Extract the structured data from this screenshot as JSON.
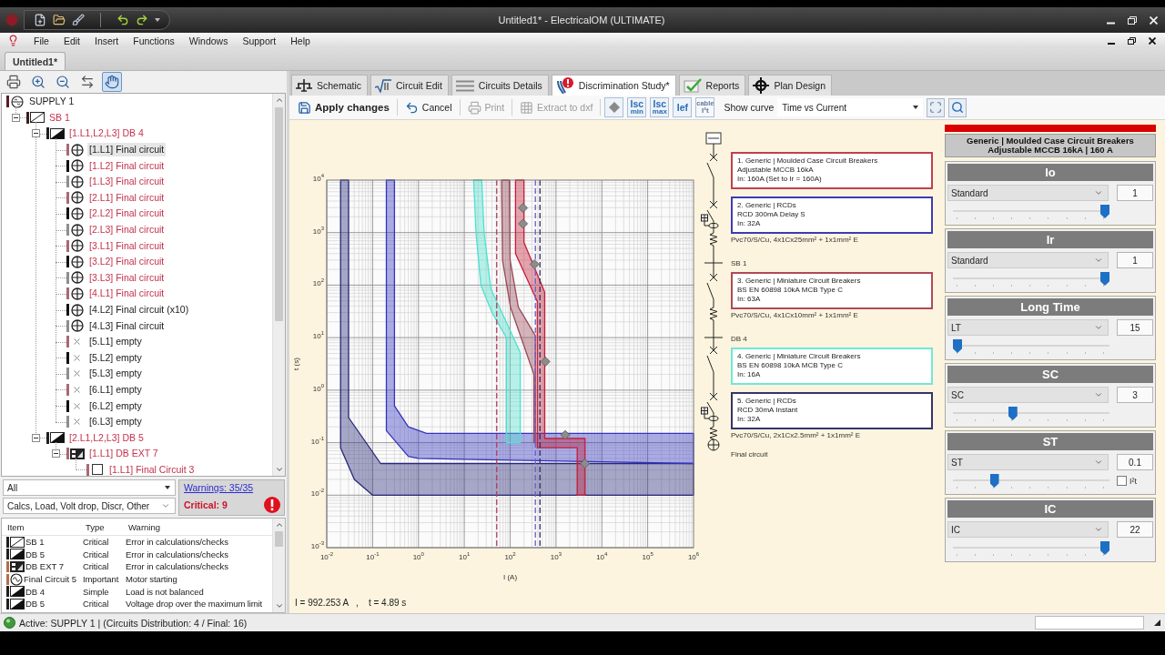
{
  "window": {
    "title": "Untitled1* - ElectricalOM (ULTIMATE)"
  },
  "menu": [
    "File",
    "Edit",
    "Insert",
    "Functions",
    "Windows",
    "Support",
    "Help"
  ],
  "document_tabs": [
    {
      "label": "Untitled1*",
      "selected": true
    }
  ],
  "tree_toolbar": [
    {
      "kind": "print",
      "pressed": false
    },
    {
      "kind": "zoom_in",
      "pressed": false
    },
    {
      "kind": "zoom_out",
      "pressed": false
    },
    {
      "kind": "swap",
      "pressed": false
    },
    {
      "kind": "hand",
      "pressed": true
    }
  ],
  "tree": [
    {
      "label": "SUPPLY 1",
      "kind": "supply",
      "color": "#5a1c24",
      "error": false,
      "selected": false,
      "children": [
        {
          "label": "SB 1",
          "kind": "switchboard",
          "color": "#3a2020",
          "error": true,
          "selected": false,
          "expanded": true,
          "children": [
            {
              "label": "[1.L1,L2,L3] DB 4",
              "kind": "board",
              "color": "#202020",
              "error": true,
              "selected": false,
              "expanded": true,
              "children": [
                {
                  "label": "[1.L1] Final circuit",
                  "kind": "final_circuit",
                  "color": "#a86a72",
                  "error": false,
                  "selected": true
                },
                {
                  "label": "[1.L2] Final circuit",
                  "kind": "final_circuit",
                  "color": "#111111",
                  "error": true,
                  "selected": false
                },
                {
                  "label": "[1.L3] Final circuit",
                  "kind": "final_circuit",
                  "color": "#8e8e8e",
                  "error": true,
                  "selected": false
                },
                {
                  "label": "[2.L1] Final circuit",
                  "kind": "final_circuit",
                  "color": "#a86a72",
                  "error": true,
                  "selected": false
                },
                {
                  "label": "[2.L2] Final circuit",
                  "kind": "final_circuit",
                  "color": "#111111",
                  "error": true,
                  "selected": false
                },
                {
                  "label": "[2.L3] Final circuit",
                  "kind": "final_circuit",
                  "color": "#8e8e8e",
                  "error": true,
                  "selected": false
                },
                {
                  "label": "[3.L1] Final circuit",
                  "kind": "final_circuit",
                  "color": "#a86a72",
                  "error": true,
                  "selected": false
                },
                {
                  "label": "[3.L2] Final circuit",
                  "kind": "final_circuit",
                  "color": "#111111",
                  "error": true,
                  "selected": false
                },
                {
                  "label": "[3.L3] Final circuit",
                  "kind": "final_circuit",
                  "color": "#8e8e8e",
                  "error": true,
                  "selected": false
                },
                {
                  "label": "[4.L1] Final circuit",
                  "kind": "final_circuit",
                  "color": "#a86a72",
                  "error": true,
                  "selected": false
                },
                {
                  "label": "[4.L2] Final circuit (x10)",
                  "kind": "final_circuit",
                  "color": "#111111",
                  "error": false,
                  "selected": false
                },
                {
                  "label": "[4.L3] Final circuit",
                  "kind": "final_circuit",
                  "color": "#8e8e8e",
                  "error": false,
                  "selected": false
                },
                {
                  "label": "[5.L1] empty",
                  "kind": "empty",
                  "color": "#a86a72",
                  "error": false,
                  "selected": false
                },
                {
                  "label": "[5.L2] empty",
                  "kind": "empty",
                  "color": "#111111",
                  "error": false,
                  "selected": false
                },
                {
                  "label": "[5.L3] empty",
                  "kind": "empty",
                  "color": "#8e8e8e",
                  "error": false,
                  "selected": false
                },
                {
                  "label": "[6.L1] empty",
                  "kind": "empty",
                  "color": "#a86a72",
                  "error": false,
                  "selected": false
                },
                {
                  "label": "[6.L2] empty",
                  "kind": "empty",
                  "color": "#111111",
                  "error": false,
                  "selected": false
                },
                {
                  "label": "[6.L3] empty",
                  "kind": "empty",
                  "color": "#8e8e8e",
                  "error": false,
                  "selected": false
                }
              ]
            },
            {
              "label": "[2.L1,L2,L3] DB 5",
              "kind": "board",
              "color": "#202020",
              "error": true,
              "selected": false,
              "expanded": true,
              "children": [
                {
                  "label": "[1.L1] DB EXT 7",
                  "kind": "ext_board",
                  "color": "#a86a72",
                  "error": true,
                  "selected": false,
                  "expanded": true,
                  "children": [
                    {
                      "label": "[1.L1] Final Circuit 3",
                      "kind": "circuit",
                      "color": "#a86a72",
                      "error": true,
                      "selected": false
                    }
                  ]
                }
              ]
            }
          ]
        }
      ]
    }
  ],
  "warnings": {
    "filter": "All",
    "categories": "Calcs, Load, Volt drop, Discr, Other",
    "summary_link": "Warnings: 35/35",
    "critical": "Critical: 9",
    "columns": [
      "Item",
      "Type",
      "Warning"
    ],
    "rows": [
      {
        "kind": "switchboard",
        "color": "#202020",
        "item": "SB 1",
        "type": "Critical",
        "warning": "Error in calculations/checks"
      },
      {
        "kind": "board",
        "color": "#202020",
        "item": "DB 5",
        "type": "Critical",
        "warning": "Error in calculations/checks"
      },
      {
        "kind": "ext_board",
        "color": "#b0704a",
        "item": "DB EXT 7",
        "type": "Critical",
        "warning": "Error in calculations/checks"
      },
      {
        "kind": "motor",
        "color": "#b0704a",
        "item": "Final Circuit 5",
        "type": "Important",
        "warning": "Motor starting"
      },
      {
        "kind": "board",
        "color": "#202020",
        "item": "DB 4",
        "type": "Simple",
        "warning": "Load is not balanced"
      },
      {
        "kind": "board",
        "color": "#202020",
        "item": "DB 5",
        "type": "Critical",
        "warning": "Voltage drop over the maximum limit"
      }
    ]
  },
  "tabs": [
    {
      "kind": "schematic",
      "label": "Schematic",
      "selected": false
    },
    {
      "kind": "circuit_edit",
      "label": "Circuit Edit",
      "selected": false
    },
    {
      "kind": "details",
      "label": "Circuits Details",
      "selected": false
    },
    {
      "kind": "discrimination",
      "label": "Discrimination Study*",
      "selected": true
    },
    {
      "kind": "reports",
      "label": "Reports",
      "selected": false
    },
    {
      "kind": "plan",
      "label": "Plan Design",
      "selected": false
    }
  ],
  "toolbar": {
    "buttons": [
      {
        "kind": "save",
        "label": "Apply changes",
        "disabled": false
      },
      {
        "kind": "undo",
        "label": "Cancel",
        "disabled": false
      },
      {
        "kind": "print",
        "label": "Print",
        "disabled": true
      },
      {
        "kind": "dxf",
        "label": "Extract to dxf",
        "disabled": true
      }
    ],
    "toggles": [
      {
        "kind": "diamond",
        "disabled": false
      },
      {
        "kind": "text",
        "top": "Isc",
        "bottom": "min",
        "disabled": false
      },
      {
        "kind": "text",
        "top": "Isc",
        "bottom": "max",
        "disabled": false
      },
      {
        "kind": "text",
        "top": "Ief",
        "disabled": false
      },
      {
        "kind": "text",
        "top": "cable",
        "bottom": "I²t",
        "disabled": true
      }
    ],
    "curve_label": "Show curve",
    "curve_select": "Time vs Current"
  },
  "study": {
    "chart_data": [
      {
        "type": "area",
        "xlabel": "I (A)",
        "ylabel": "t (s)",
        "log": "both",
        "grid": true,
        "xlim": [
          0.01,
          1000000
        ],
        "ylim": [
          0.001,
          10000
        ],
        "xticks": [
          {
            "value": 0.01,
            "label": "10$^{-2}$"
          },
          {
            "value": 0.1,
            "label": "10$^{-1}$"
          },
          {
            "value": 1,
            "label": "10$^{0}$"
          },
          {
            "value": 10,
            "label": "10$^{1}$"
          },
          {
            "value": 100,
            "label": "10$^{2}$"
          },
          {
            "value": 1000,
            "label": "10$^{3}$"
          },
          {
            "value": 10000,
            "label": "10$^{4}$"
          },
          {
            "value": 100000,
            "label": "10$^{5}$"
          },
          {
            "value": 1000000,
            "label": "10$^{6}$"
          }
        ],
        "yticks": [
          {
            "value": 0.001,
            "label": "10$^{-3}$"
          },
          {
            "value": 0.01,
            "label": "10$^{-2}$"
          },
          {
            "value": 0.1,
            "label": "10$^{-1}$"
          },
          {
            "value": 1,
            "label": "10$^{0}$"
          },
          {
            "value": 10,
            "label": "10$^{1}$"
          },
          {
            "value": 100,
            "label": "10$^{2}$"
          },
          {
            "value": 1000,
            "label": "10$^{3}$"
          },
          {
            "value": 10000,
            "label": "10$^{4}$"
          }
        ],
        "series": [
          {
            "color": "#28287a",
            "x": [
              0.02,
              0.02,
              0.04,
              0.1,
              1000000,
              1000000,
              0.15,
              0.03,
              0.03
            ],
            "values": [
              10000,
              0.08,
              0.02,
              0.01,
              0.01,
              0.04,
              0.04,
              0.3,
              10000
            ]
          },
          {
            "color": "#3434c0",
            "x": [
              0.2,
              0.2,
              0.6,
              1,
              1000000,
              1000000,
              1.5,
              0.6,
              0.3,
              0.3
            ],
            "values": [
              10000,
              0.17,
              0.055,
              0.05,
              0.04,
              0.15,
              0.15,
              0.2,
              0.5,
              10000
            ]
          },
          {
            "color": "#4fe0d0",
            "x": [
              16,
              18,
              23,
              41,
              83,
              83,
              166,
              166,
              89,
              38,
              27,
              24
            ],
            "values": [
              10000,
              1000,
              100,
              29,
              10,
              0.1,
              0.1,
              5.2,
              17,
              85,
              1000,
              10000
            ]
          },
          {
            "color": "#9a4a5a",
            "x": [
              65,
              68,
              102,
              330,
              330,
              355,
              355,
              151,
              100,
              96
            ],
            "values": [
              10000,
              300,
              38,
              2,
              0.1,
              0.1,
              11,
              38,
              300,
              10000
            ]
          },
          {
            "color": "#c41e3a",
            "x": [
              131,
              131,
              390,
              390,
              2900,
              2900,
              4300,
              4300,
              565,
              565,
              200,
              200
            ],
            "values": [
              10000,
              400,
              49,
              0.08,
              0.08,
              0.01,
              0.01,
              0.12,
              0.12,
              74,
              650,
              10000
            ]
          },
          {
            "type": "scatter",
            "marker": "diamond",
            "color": "#8c8c8c",
            "x": [
              191,
              191,
              340,
              590,
              1590,
              4270
            ],
            "values": [
              2950,
              1480,
              250,
              3.5,
              0.14,
              0.04
            ]
          }
        ],
        "ref_lines": [
          {
            "axis": "x",
            "value": 51,
            "color": "#b03c5c",
            "line_style": "dashed"
          },
          {
            "axis": "x",
            "value": 355,
            "color": "#6a5acd",
            "line_style": "dashed"
          },
          {
            "axis": "x",
            "value": 447,
            "color": "#2c2c5c",
            "line_style": "dashed"
          }
        ]
      }
    ],
    "readout": "I = 992.253 A   ,    t = 4.89 s"
  },
  "diagram": {
    "items": [
      {
        "kind": "device",
        "color": "#c0404c",
        "lines": [
          "1. Generic | Moulded Case Circuit Breakers",
          "Adjustable MCCB 16kA",
          "In: 160A (Set to Ir = 160A)"
        ]
      },
      {
        "kind": "device",
        "color": "#3c3cb4",
        "lines": [
          "2. Generic | RCDs",
          "RCD 300mA Delay S",
          "In: 32A"
        ]
      },
      {
        "kind": "cable",
        "text": "Pvc70/S/Cu, 4x1Cx25mm² + 1x1mm² E"
      },
      {
        "kind": "board",
        "text": "SB 1"
      },
      {
        "kind": "device",
        "color": "#b04a58",
        "lines": [
          "3. Generic | Miniature Circuit Breakers",
          "BS EN 60898 10kA MCB Type C",
          "In: 63A"
        ]
      },
      {
        "kind": "cable",
        "text": "Pvc70/S/Cu, 4x1Cx10mm² + 1x1mm² E"
      },
      {
        "kind": "board",
        "text": "DB 4"
      },
      {
        "kind": "device",
        "color": "#70e8d8",
        "lines": [
          "4. Generic | Miniature Circuit Breakers",
          "BS EN 60898 10kA MCB Type C",
          "In: 16A"
        ]
      },
      {
        "kind": "device",
        "color": "#34346c",
        "lines": [
          "5. Generic | RCDs",
          "RCD 30mA Instant",
          "In: 32A"
        ]
      },
      {
        "kind": "cable",
        "text": "Pvc70/S/Cu, 2x1Cx2.5mm² + 1x1mm² E"
      },
      {
        "kind": "load",
        "text": "Final circuit"
      }
    ]
  },
  "settings": {
    "title": [
      "Generic | Moulded Case Circuit Breakers",
      "Adjustable MCCB 16kA | 160 A"
    ],
    "groups": [
      {
        "title": "Io",
        "mode": "Standard",
        "value": "1",
        "level": 1
      },
      {
        "title": "Ir",
        "mode": "Standard",
        "value": "1",
        "level": 1
      },
      {
        "title": "Long Time",
        "mode": "LT",
        "value": "15",
        "level": 0
      },
      {
        "title": "SC",
        "mode": "SC",
        "value": "3",
        "level": 0.375
      },
      {
        "title": "ST",
        "mode": "ST",
        "value": "0.1",
        "level": 0.25,
        "option": {
          "label": "I²t",
          "checked": false
        }
      },
      {
        "title": "IC",
        "mode": "IC",
        "value": "22",
        "level": 1
      }
    ]
  },
  "status_bar": {
    "text": "Active: SUPPLY 1 | (Circuits Distribution: 4 / Final: 16)"
  }
}
